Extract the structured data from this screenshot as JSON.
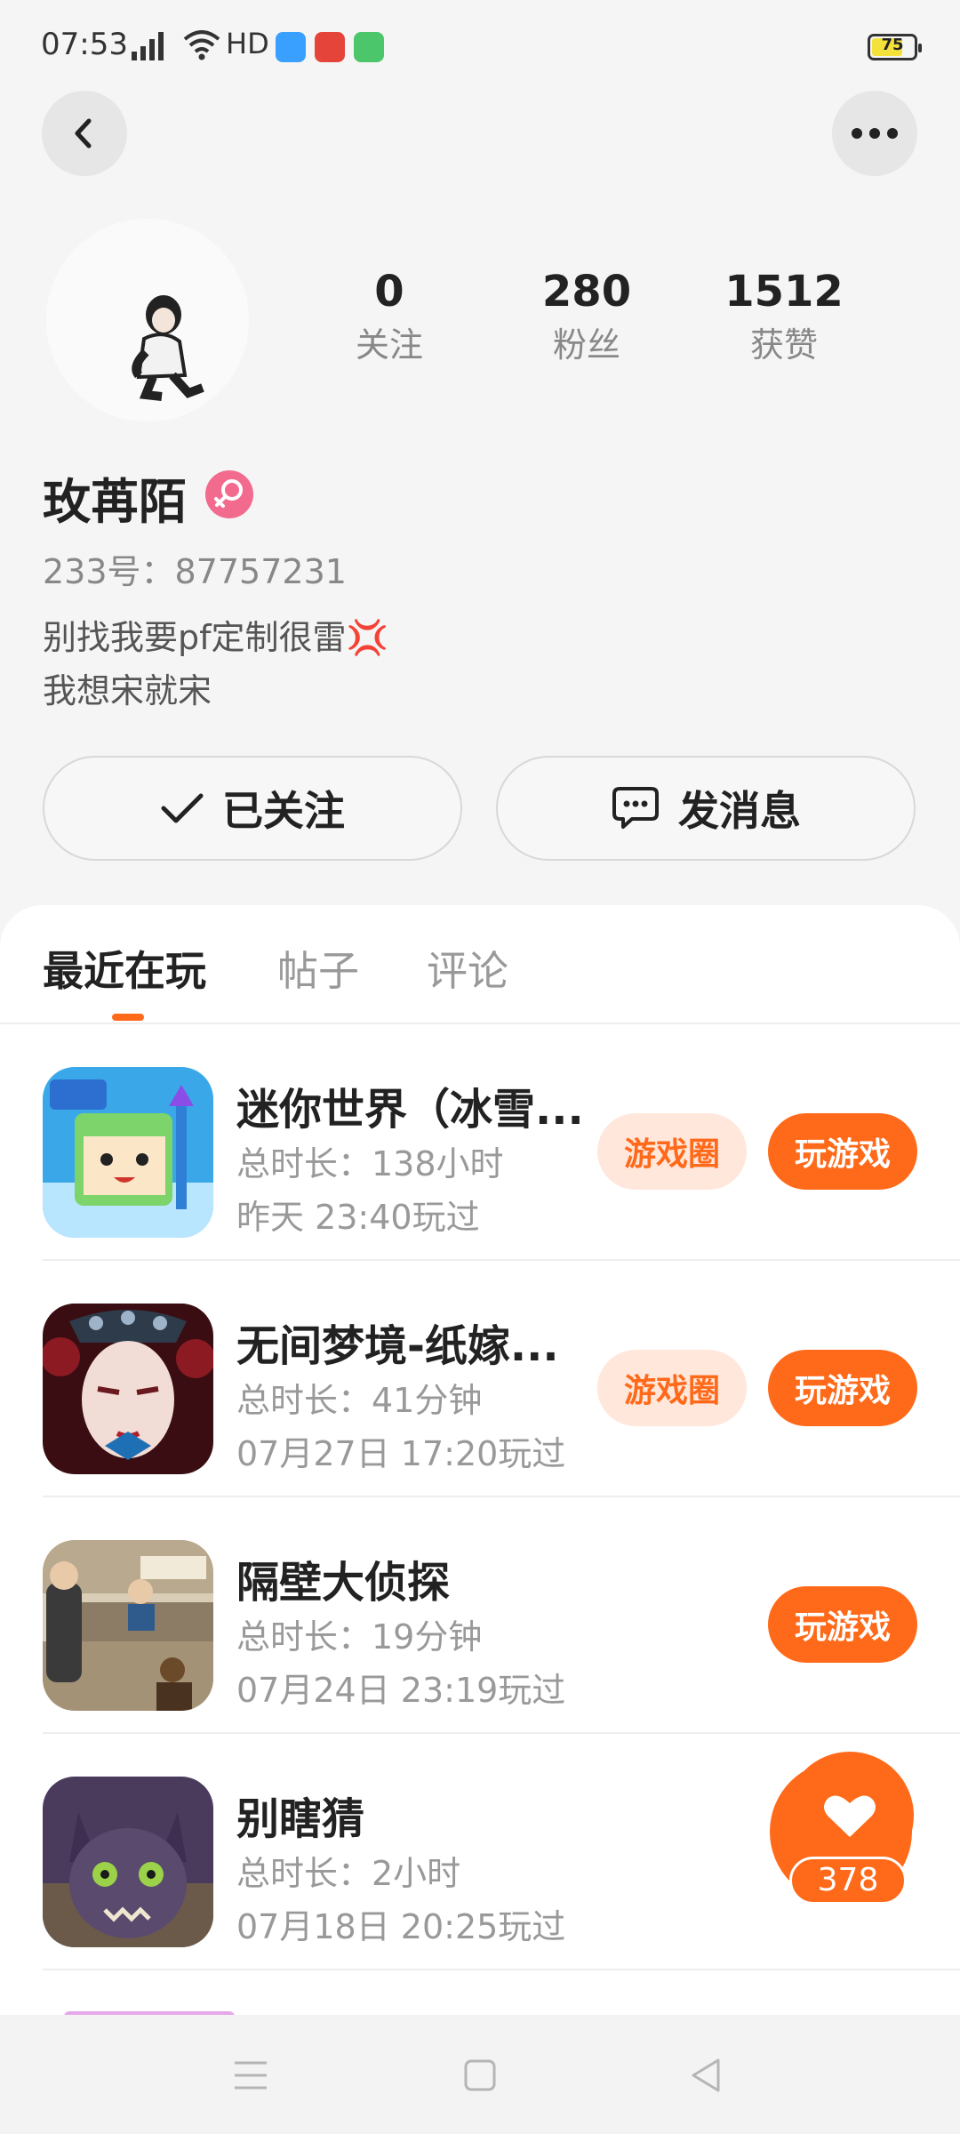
{
  "status_bar": {
    "time": "07:53",
    "network": "HD",
    "battery": "75",
    "battery_level": 0.75
  },
  "profile": {
    "name": "玫苒陌",
    "id_label": "233号：87757231",
    "bio_line1": "别找我要pf定制很雷💢",
    "bio_line2": "我想宋就宋",
    "stats": [
      {
        "value": "0",
        "label": "关注"
      },
      {
        "value": "280",
        "label": "粉丝"
      },
      {
        "value": "1512",
        "label": "获赞"
      }
    ]
  },
  "actions": {
    "follow_label": "已关注",
    "message_label": "发消息"
  },
  "tabs": [
    {
      "label": "最近在玩",
      "active": true
    },
    {
      "label": "帖子",
      "active": false
    },
    {
      "label": "评论",
      "active": false
    }
  ],
  "games": [
    {
      "title": "迷你世界（冰雪...",
      "duration": "总时长：138小时",
      "last_played": "昨天 23:40玩过",
      "circle_label": "游戏圈",
      "play_label": "玩游戏"
    },
    {
      "title": "无间梦境-纸嫁...",
      "duration": "总时长：41分钟",
      "last_played": "07月27日 17:20玩过",
      "circle_label": "游戏圈",
      "play_label": "玩游戏"
    },
    {
      "title": "隔壁大侦探",
      "duration": "总时长：19分钟",
      "last_played": "07月24日 23:19玩过",
      "play_label": "玩游戏"
    },
    {
      "title": "别瞎猜",
      "duration": "总时长：2小时",
      "last_played": "07月18日 20:25玩过"
    }
  ],
  "like": {
    "count": "378"
  },
  "colors": {
    "accent": "#ff6a1a",
    "accent_light": "#ffe7dc",
    "background": "#f5f5f5"
  }
}
